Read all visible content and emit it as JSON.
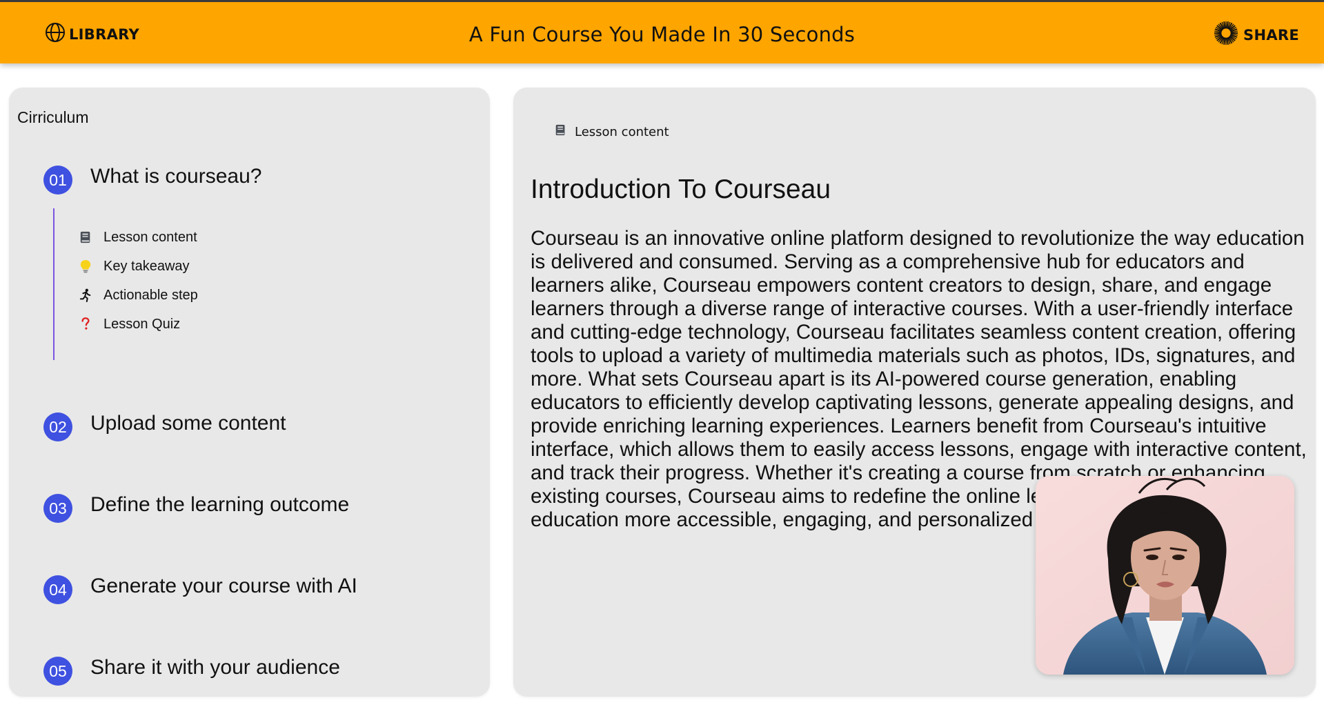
{
  "header": {
    "library_label": "LIBRARY",
    "title": "A Fun Course You Made In 30 Seconds",
    "share_label": "SHARE",
    "background_color": "#ffa500"
  },
  "curriculum": {
    "title": "Cirriculum",
    "modules": [
      {
        "number": "01",
        "title": "What is courseau?",
        "expanded": true,
        "items": [
          {
            "icon": "book-icon",
            "label": "Lesson content"
          },
          {
            "icon": "lightbulb-icon",
            "label": "Key takeaway"
          },
          {
            "icon": "running-person-icon",
            "label": "Actionable step"
          },
          {
            "icon": "question-mark-icon",
            "label": "Lesson Quiz"
          }
        ]
      },
      {
        "number": "02",
        "title": "Upload some content",
        "expanded": false
      },
      {
        "number": "03",
        "title": "Define the learning outcome",
        "expanded": false
      },
      {
        "number": "04",
        "title": "Generate your course with AI",
        "expanded": false
      },
      {
        "number": "05",
        "title": "Share it with your audience",
        "expanded": false
      }
    ],
    "module_badge_color": "#3f51e0",
    "timeline_color": "#7b55e0"
  },
  "lesson": {
    "section_label": "Lesson content",
    "section_icon": "book-icon",
    "title": "Introduction To Courseau",
    "body": "Courseau is an innovative online platform designed to revolutionize the way education is delivered and consumed. Serving as a comprehensive hub for educators and learners alike, Courseau empowers content creators to design, share, and engage learners through a diverse range of interactive courses. With a user-friendly interface and cutting-edge technology, Courseau facilitates seamless content creation, offering tools to upload a variety of multimedia materials such as photos, IDs, signatures, and more. What sets Courseau apart is its AI-powered course generation, enabling educators to efficiently develop captivating lessons, generate appealing designs, and provide enriching learning experiences. Learners benefit from Courseau's intuitive interface, which allows them to easily access lessons, engage with interactive content, and track their progress. Whether it's creating a course from scratch or enhancing existing courses, Courseau aims to redefine the online learning landscape, making education more accessible, engaging, and personalized than ever before."
  },
  "presenter_video": {
    "icon": "presenter-avatar-video"
  }
}
